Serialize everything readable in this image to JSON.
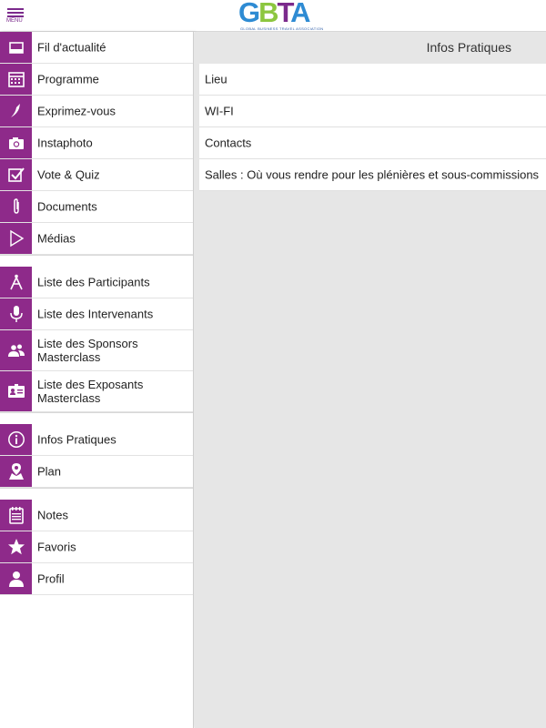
{
  "header": {
    "menu_label": "MENU",
    "logo_text": "GBTA",
    "logo_tagline": "GLOBAL BUSINESS TRAVEL ASSOCIATION"
  },
  "colors": {
    "accent": "#8e2a8a",
    "panel_bg": "#e6e6e6"
  },
  "sidebar": {
    "group1": [
      {
        "label": "Fil d'actualité",
        "icon": "news-icon"
      },
      {
        "label": "Programme",
        "icon": "calendar-icon"
      },
      {
        "label": "Exprimez-vous",
        "icon": "megaphone-icon"
      },
      {
        "label": "Instaphoto",
        "icon": "camera-icon"
      },
      {
        "label": "Vote & Quiz",
        "icon": "checkbox-icon"
      },
      {
        "label": "Documents",
        "icon": "paperclip-icon"
      },
      {
        "label": "Médias",
        "icon": "play-icon"
      }
    ],
    "group2": [
      {
        "label": "Liste des Participants",
        "icon": "compass-icon"
      },
      {
        "label": "Liste des Intervenants",
        "icon": "microphone-icon"
      },
      {
        "label": "Liste des Sponsors Masterclass",
        "icon": "people-icon"
      },
      {
        "label": "Liste des Exposants Masterclass",
        "icon": "id-card-icon"
      }
    ],
    "group3": [
      {
        "label": "Infos Pratiques",
        "icon": "info-icon"
      },
      {
        "label": "Plan",
        "icon": "map-pin-icon"
      }
    ],
    "group4": [
      {
        "label": "Notes",
        "icon": "notepad-icon"
      },
      {
        "label": "Favoris",
        "icon": "star-icon"
      },
      {
        "label": "Profil",
        "icon": "user-icon"
      }
    ]
  },
  "main": {
    "title": "Infos Pratiques",
    "items": [
      "Lieu",
      "WI-FI",
      "Contacts",
      "Salles : Où vous rendre pour les plénières et sous-commissions"
    ]
  }
}
